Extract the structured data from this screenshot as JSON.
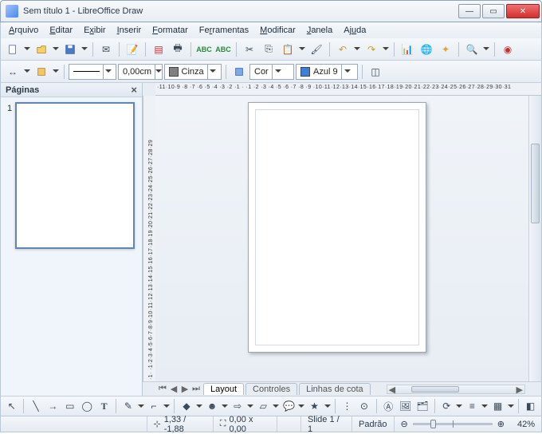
{
  "window": {
    "title": "Sem título 1 - LibreOffice Draw"
  },
  "menu": {
    "arquivo": "Arquivo",
    "editar": "Editar",
    "exibir": "Exibir",
    "inserir": "Inserir",
    "formatar": "Formatar",
    "ferramentas": "Ferramentas",
    "modificar": "Modificar",
    "janela": "Janela",
    "ajuda": "Ajuda"
  },
  "toolbar2": {
    "lineWidth": "0,00cm",
    "lineColor": "Cinza",
    "lineSwatch": "#808080",
    "fillType": "Cor",
    "fillName": "Azul 9",
    "fillSwatch": "#3a7fd8"
  },
  "panel": {
    "title": "Páginas",
    "slideNum": "1"
  },
  "ruler": {
    "h": "·11·10·9 ·8 ·7 ·6 ·5 ·4 ·3 ·2 ·1 · ·1 ·2 ·3 ·4 ·5 ·6 ·7 ·8 ·9 ·10·11·12·13·14·15·16·17·18·19·20·21·22·23·24·25·26·27·28·29·30·31",
    "v": "·1· ·1·2·3·4·5·6·7·8·9·10·11·12·13·14·15·16·17·18·19·20·21·22·23·24·25·26·27·28·29"
  },
  "tabs": {
    "layout": "Layout",
    "controles": "Controles",
    "linhas": "Linhas de cota"
  },
  "status": {
    "coords": "1,33 / -1,88",
    "size": "0,00 x 0,00",
    "slide": "Slide 1 / 1",
    "style": "Padrão",
    "zoom": "42%"
  }
}
